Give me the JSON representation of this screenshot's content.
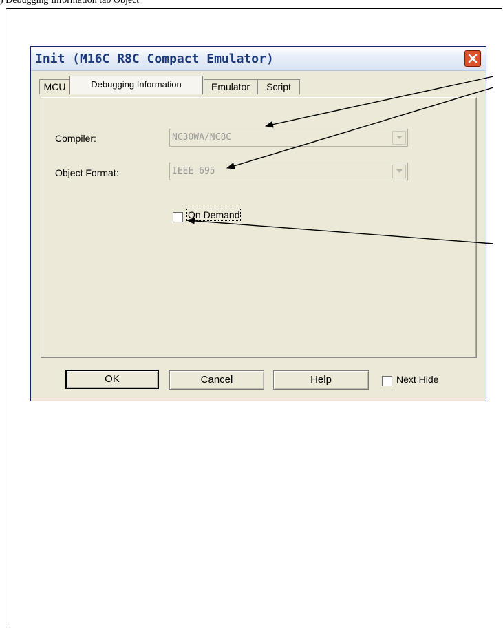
{
  "header_fragment": ") Debugging Information       tab       Object",
  "dialog": {
    "title": "Init (M16C R8C Compact Emulator)",
    "tabs": [
      {
        "label": "MCU",
        "active": false
      },
      {
        "label": "Debugging Information",
        "active": true
      },
      {
        "label": "Emulator",
        "active": false
      },
      {
        "label": "Script",
        "active": false
      }
    ],
    "compiler": {
      "label": "Compiler:",
      "value": "NC30WA/NC8C"
    },
    "object_format": {
      "label": "Object Format:",
      "value": "IEEE-695"
    },
    "on_demand": {
      "label": "On Demand",
      "checked": false
    },
    "buttons": {
      "ok": "OK",
      "cancel": "Cancel",
      "help": "Help"
    },
    "next_hide": {
      "label": "Next Hide",
      "checked": false
    }
  },
  "colors": {
    "title_text": "#1d3a78",
    "close_button": "#d9532c",
    "dialog_bg": "#ece9d8"
  },
  "icons": {
    "close": "close-icon",
    "dropdown": "chevron-down-icon"
  }
}
